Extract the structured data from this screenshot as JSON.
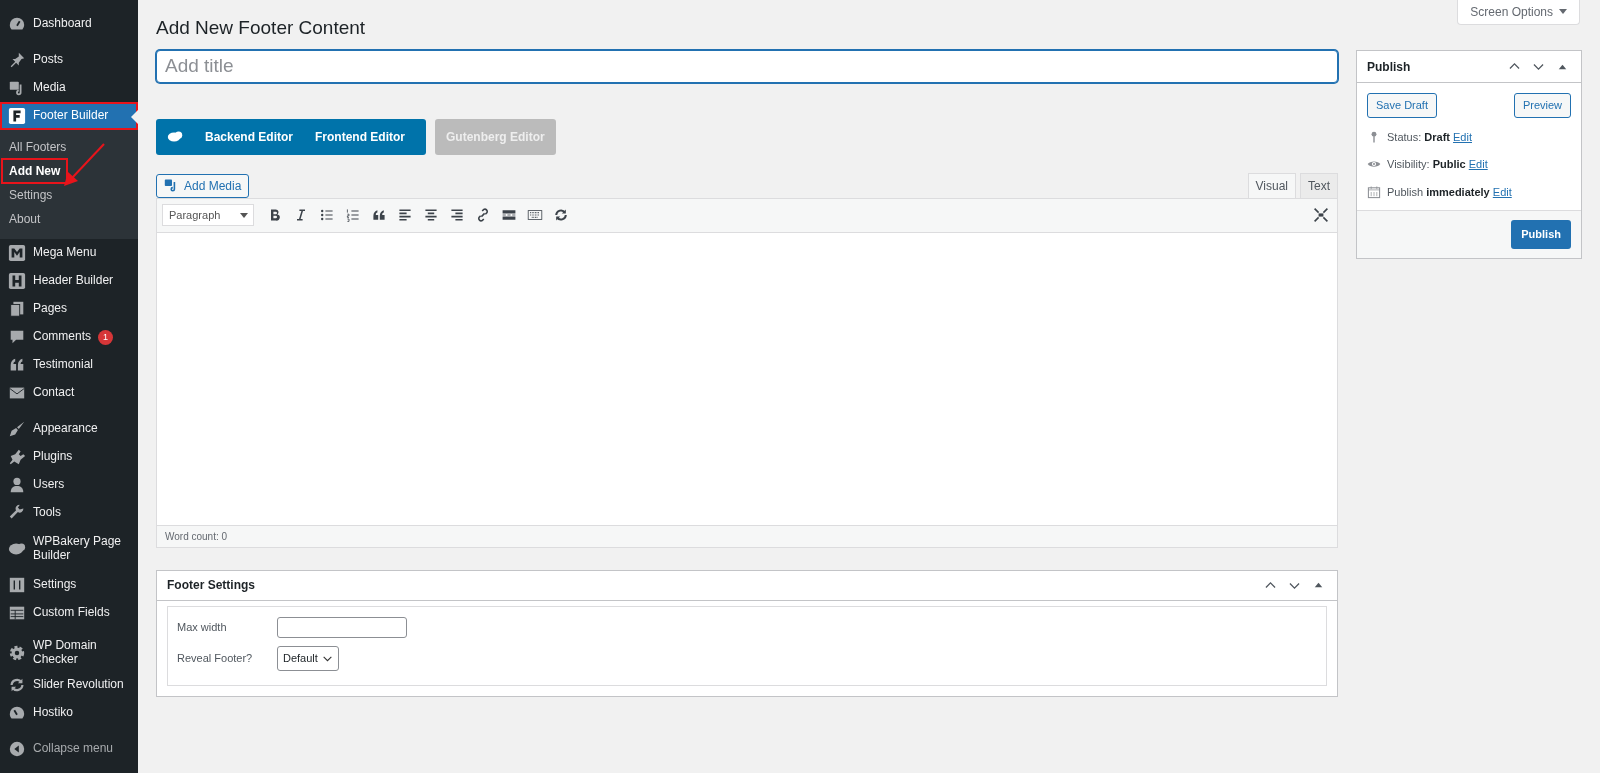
{
  "sidebar": {
    "groups": [
      [
        {
          "label": "Dashboard",
          "selected": false
        }
      ],
      [
        {
          "label": "Posts",
          "selected": false
        },
        {
          "label": "Media",
          "selected": false
        },
        {
          "label": "Footer Builder",
          "selected": true,
          "highlighted": true,
          "children": [
            {
              "label": "All Footers",
              "selected": false,
              "highlighted": false
            },
            {
              "label": "Add New",
              "selected": true,
              "highlighted": true
            },
            {
              "label": "Settings",
              "selected": false,
              "highlighted": false
            },
            {
              "label": "About",
              "selected": false,
              "highlighted": false
            }
          ]
        },
        {
          "label": "Mega Menu",
          "selected": false
        },
        {
          "label": "Header Builder",
          "selected": false
        },
        {
          "label": "Pages",
          "selected": false
        },
        {
          "label": "Comments",
          "selected": false,
          "badge": "1"
        },
        {
          "label": "Testimonial",
          "selected": false
        },
        {
          "label": "Contact",
          "selected": false
        }
      ],
      [
        {
          "label": "Appearance",
          "selected": false
        },
        {
          "label": "Plugins",
          "selected": false
        },
        {
          "label": "Users",
          "selected": false
        },
        {
          "label": "Tools",
          "selected": false
        },
        {
          "label": "WPBakery Page Builder",
          "selected": false
        },
        {
          "label": "Settings",
          "selected": false
        },
        {
          "label": "Custom Fields",
          "selected": false
        }
      ],
      [
        {
          "label": "WP Domain Checker",
          "selected": false
        },
        {
          "label": "Slider Revolution",
          "selected": false
        },
        {
          "label": "Hostiko",
          "selected": false
        }
      ]
    ],
    "collapse": "Collapse menu"
  },
  "screen_options": "Screen Options",
  "page_title": "Add New Footer Content",
  "title_field": {
    "placeholder": "Add title"
  },
  "editor_modes": [
    {
      "label": "Backend Editor",
      "disabled": false
    },
    {
      "label": "Frontend Editor",
      "disabled": false
    },
    {
      "label": "Gutenberg Editor",
      "disabled": true
    }
  ],
  "add_media": "Add Media",
  "editor_tabs": [
    {
      "label": "Visual",
      "selected": true
    },
    {
      "label": "Text",
      "selected": false
    }
  ],
  "format_select": "Paragraph",
  "word_count": "Word count: 0",
  "footer_settings": {
    "title": "Footer Settings",
    "fields": [
      {
        "kind": "text",
        "label": "Max width"
      },
      {
        "kind": "select",
        "label": "Reveal Footer?",
        "value": "Default"
      }
    ]
  },
  "publish": {
    "title": "Publish",
    "save_draft": "Save Draft",
    "preview": "Preview",
    "rows": [
      "Status: **Draft**",
      "Visibility: **Public**",
      "Publish **immediately**"
    ],
    "edit_link": [
      "Edit",
      "Edit",
      "Edit"
    ],
    "button": "Publish"
  }
}
